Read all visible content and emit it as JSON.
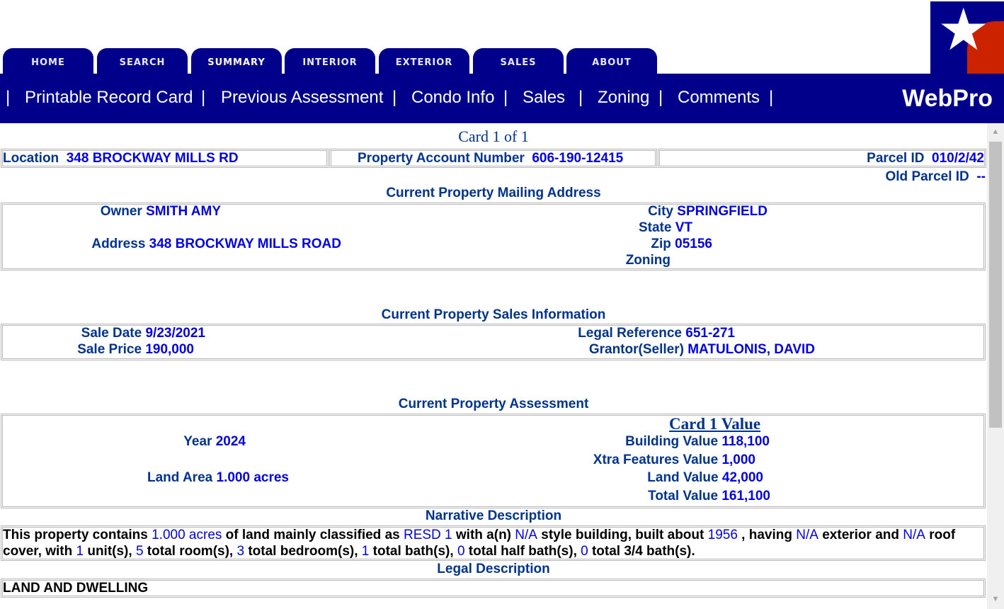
{
  "tabs": [
    "HOME",
    "SEARCH",
    "SUMMARY",
    "INTERIOR",
    "EXTERIOR",
    "SALES",
    "ABOUT"
  ],
  "nav": {
    "sep": "|",
    "links": [
      "Printable Record Card",
      "Previous Assessment",
      "Condo Info",
      "Sales",
      "Zoning",
      "Comments"
    ],
    "brand": "WebPro"
  },
  "card": "Card 1 of 1",
  "header": {
    "location_label": "Location",
    "location": "348 BROCKWAY MILLS RD",
    "account_label": "Property Account Number",
    "account": "606-190-12415",
    "parcel_label": "Parcel ID",
    "parcel": "010/2/42",
    "old_parcel_label": "Old Parcel ID",
    "old_parcel": "--"
  },
  "mailing": {
    "title": "Current Property Mailing Address",
    "owner_label": "Owner",
    "owner": "SMITH AMY",
    "address_label": "Address",
    "address": "348 BROCKWAY MILLS ROAD",
    "city_label": "City",
    "city": "SPRINGFIELD",
    "state_label": "State",
    "state": "VT",
    "zip_label": "Zip",
    "zip": "05156",
    "zoning_label": "Zoning",
    "zoning": ""
  },
  "sales": {
    "title": "Current Property Sales Information",
    "date_label": "Sale Date",
    "date": "9/23/2021",
    "price_label": "Sale Price",
    "price": "190,000",
    "legal_label": "Legal Reference",
    "legal": "651-271",
    "grantor_label": "Grantor(Seller)",
    "grantor": "MATULONIS, DAVID"
  },
  "assessment": {
    "title": "Current Property Assessment",
    "card_value_title": "Card 1 Value",
    "year_label": "Year",
    "year": "2024",
    "land_area_label": "Land Area",
    "land_area": "1.000 acres",
    "building_label": "Building Value",
    "building": "118,100",
    "xtra_label": "Xtra Features Value",
    "xtra": "1,000",
    "land_label": "Land Value",
    "land": "42,000",
    "total_label": "Total Value",
    "total": "161,100"
  },
  "narrative": {
    "title": "Narrative Description",
    "t1": "This property contains ",
    "acres": "1.000 acres",
    "t2": " of land mainly classified as ",
    "class": "RESD 1",
    "t3": " with a(n) ",
    "style": "N/A",
    "t4": " style building, built about ",
    "built": "1956",
    "t5": " , having ",
    "exterior": "N/A",
    "t6": " exterior and ",
    "roof": "N/A",
    "t7": " roof cover, with ",
    "units": "1",
    "t8": " unit(s), ",
    "rooms": "5",
    "t9": " total room(s), ",
    "bedrooms": "3",
    "t10": " total bedroom(s), ",
    "baths": "1",
    "t11": " total bath(s), ",
    "half_baths": "0",
    "t12": " total half bath(s), ",
    "three_q_baths": "0",
    "t13": " total 3/4 bath(s)."
  },
  "legal": {
    "title": "Legal Description",
    "text": "LAND AND DWELLING"
  }
}
